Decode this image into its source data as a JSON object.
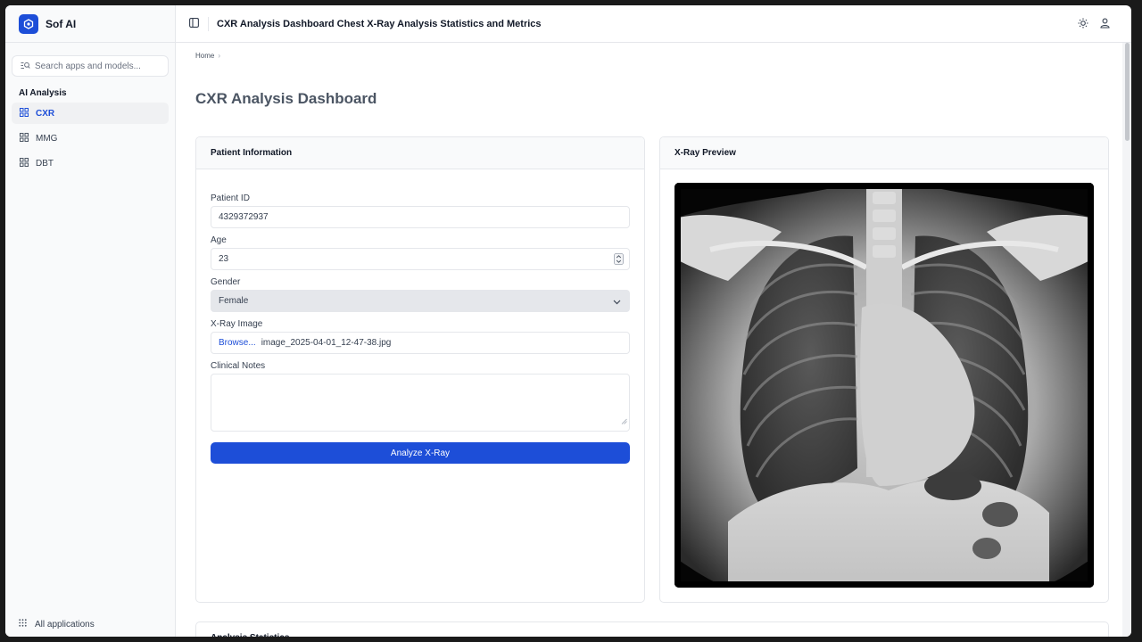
{
  "app": {
    "name": "Sof AI"
  },
  "sidebar": {
    "search_placeholder": "Search apps and models...",
    "section_title": "AI Analysis",
    "items": [
      {
        "label": "CXR",
        "active": true
      },
      {
        "label": "MMG",
        "active": false
      },
      {
        "label": "DBT",
        "active": false
      }
    ],
    "footer_label": "All applications"
  },
  "header": {
    "title": "CXR Analysis Dashboard Chest X-Ray Analysis Statistics and Metrics"
  },
  "breadcrumb": {
    "home": "Home"
  },
  "page": {
    "title": "CXR Analysis Dashboard"
  },
  "patient_card": {
    "title": "Patient Information",
    "patient_id_label": "Patient ID",
    "patient_id_value": "4329372937",
    "age_label": "Age",
    "age_value": "23",
    "gender_label": "Gender",
    "gender_value": "Female",
    "xray_label": "X-Ray Image",
    "browse_label": "Browse...",
    "file_name": "image_2025-04-01_12-47-38.jpg",
    "notes_label": "Clinical Notes",
    "notes_value": "",
    "analyze_button": "Analyze X-Ray"
  },
  "preview_card": {
    "title": "X-Ray Preview"
  },
  "stats_card": {
    "title": "Analysis Statistics"
  },
  "colors": {
    "accent": "#1d4ed8",
    "sidebar_bg": "#f9fafb",
    "border": "#e5e7eb"
  },
  "icons": [
    "logo-icon",
    "search-icon",
    "grid-icon",
    "apps-grid-icon",
    "sidebar-toggle-icon",
    "sun-icon",
    "user-icon",
    "chevron-down-icon",
    "stepper-icon",
    "resize-grip-icon"
  ]
}
